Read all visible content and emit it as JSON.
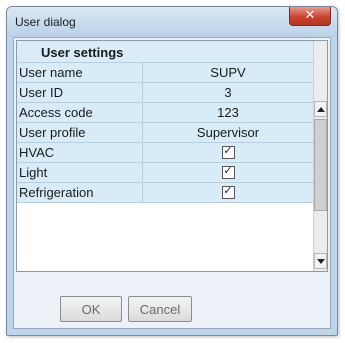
{
  "window": {
    "title": "User dialog",
    "close_symbol": "✕"
  },
  "grid": {
    "header": "User settings",
    "rows": [
      {
        "label": "User name",
        "value": "SUPV",
        "type": "text"
      },
      {
        "label": "User ID",
        "value": "3",
        "type": "text"
      },
      {
        "label": "Access code",
        "value": "123",
        "type": "text"
      },
      {
        "label": "User profile",
        "value": "Supervisor",
        "type": "text"
      },
      {
        "label": "HVAC",
        "checked": true,
        "type": "checkbox"
      },
      {
        "label": "Light",
        "checked": true,
        "type": "checkbox"
      },
      {
        "label": "Refrigeration",
        "checked": true,
        "type": "checkbox"
      }
    ],
    "check_mark": "✓"
  },
  "buttons": {
    "ok_label": "OK",
    "cancel_label": "Cancel"
  },
  "colors": {
    "row_background": "#d8ecf7",
    "frame": "#bcd5ea",
    "close_button": "#c7452f"
  }
}
